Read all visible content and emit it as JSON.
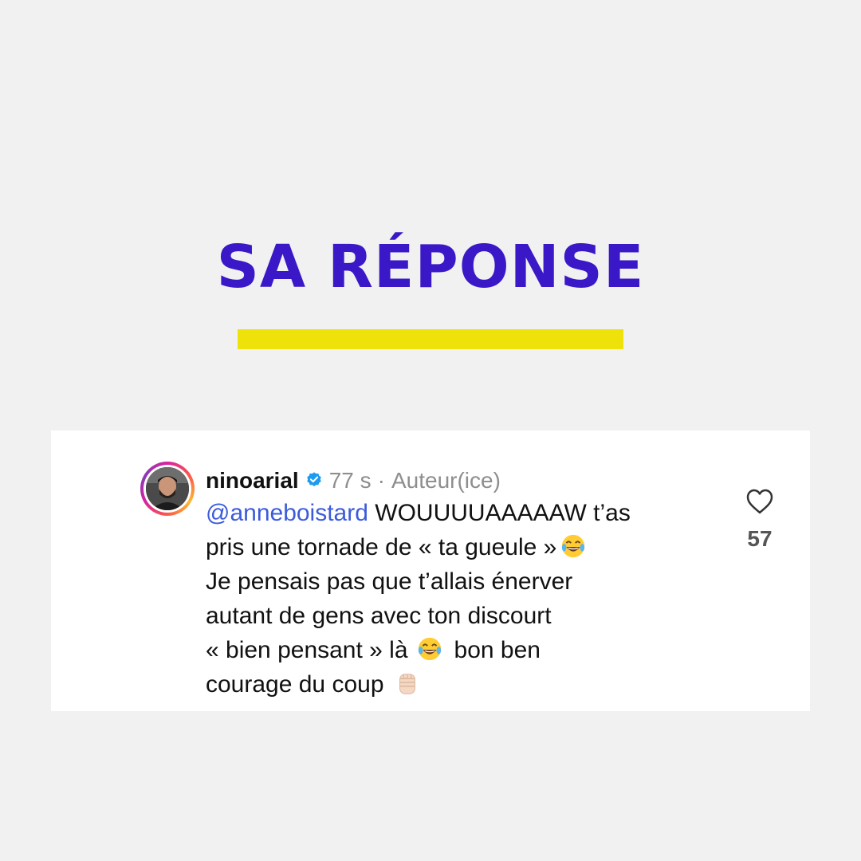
{
  "header": {
    "title": "SA RÉPONSE"
  },
  "comment": {
    "username": "ninoarial",
    "time": "77 s",
    "separator": "·",
    "role": "Auteur(ice)",
    "mention": "@anneboistard",
    "line1_rest": " WOUUUUAAAAAW t’as",
    "line2": "pris une tornade de « ta gueule »",
    "line3": "Je pensais pas que t’allais énerver",
    "line4": "autant de gens avec ton discourt",
    "line5a": "« bien pensant » là",
    "line5b": "bon ben",
    "line6": "courage du coup",
    "likes": "57"
  },
  "icons": {
    "verified": "verified-badge-icon",
    "laugh": "face-with-tears-of-joy-icon",
    "fist": "raised-fist-icon",
    "like": "heart-outline-icon"
  },
  "colors": {
    "title": "#3a18c8",
    "underline": "#eee20a",
    "mention": "#3b5bdb",
    "verified": "#1d9bf0"
  }
}
